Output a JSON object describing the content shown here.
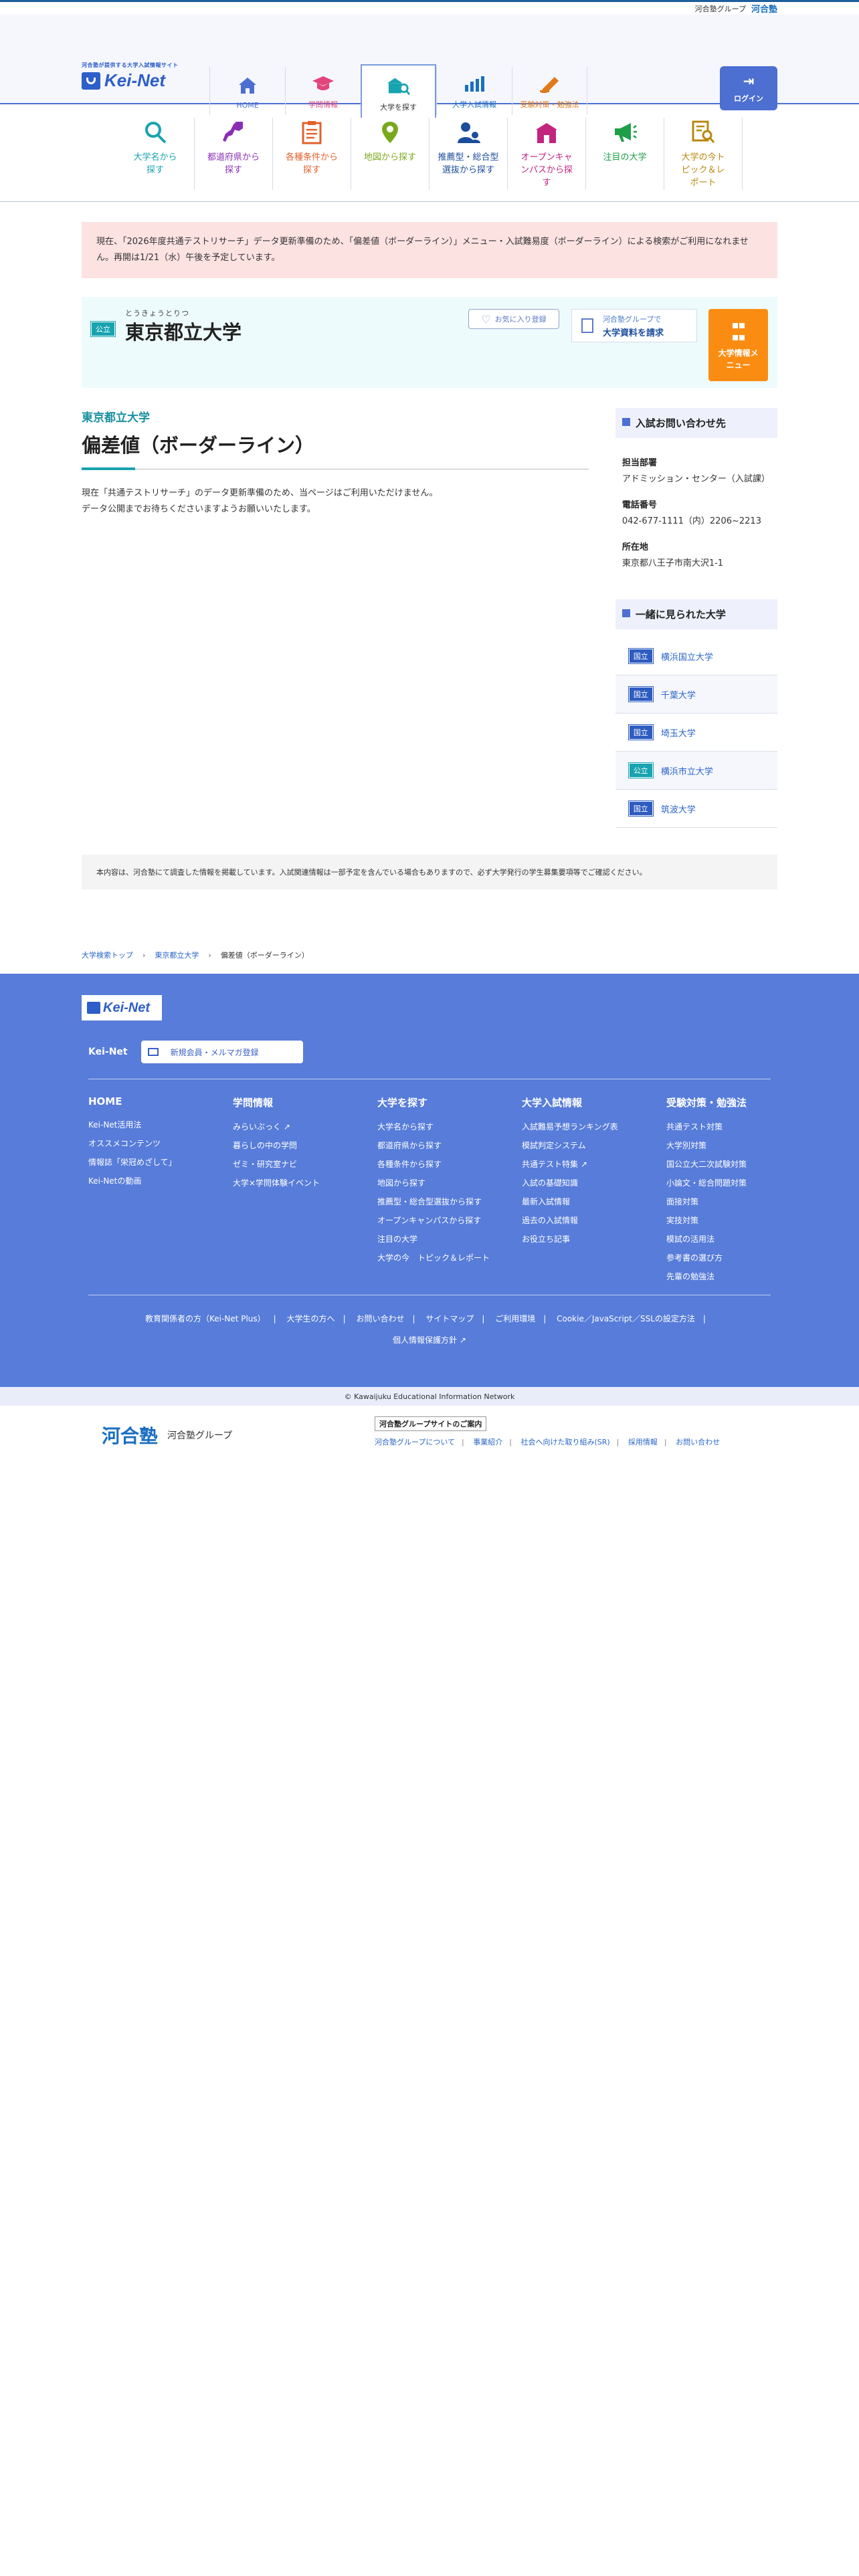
{
  "topbar": {
    "group_label": "河合塾グループ",
    "brand": "河合塾"
  },
  "logo": {
    "tagline": "河合塾が提供する大学入試情報サイト",
    "name": "Kei-Net"
  },
  "gnav": [
    {
      "label": "HOME",
      "icon": "home-icon",
      "color": "#4d6fd2"
    },
    {
      "label": "学問情報",
      "icon": "graduation-cap-icon",
      "color": "#e2457c"
    },
    {
      "label": "大学を探す",
      "icon": "university-search-icon",
      "color": "#18a3b0"
    },
    {
      "label": "大学入試情報",
      "icon": "bar-chart-icon",
      "color": "#1b6fc1"
    },
    {
      "label": "受験対策・勉強法",
      "icon": "pencil-icon",
      "color": "#e07a1b"
    }
  ],
  "login_label": "ログイン",
  "subnav": [
    {
      "label": "大学名から探す",
      "icon": "magnifier-icon",
      "color": "#18a3b0"
    },
    {
      "label": "都道府県から探す",
      "icon": "map-region-icon",
      "color": "#8a2fb5"
    },
    {
      "label": "各種条件から探す",
      "icon": "checklist-icon",
      "color": "#e2602d"
    },
    {
      "label": "地図から探す",
      "icon": "map-pin-icon",
      "color": "#7aa81c"
    },
    {
      "label": "推薦型・総合型選抜から探す",
      "icon": "people-icon",
      "color": "#1b4d9c"
    },
    {
      "label": "オープンキャンパスから探す",
      "icon": "campus-icon",
      "color": "#c2247e"
    },
    {
      "label": "注目の大学",
      "icon": "megaphone-icon",
      "color": "#1f9e4a"
    },
    {
      "label": "大学の今トピック＆レポート",
      "icon": "report-search-icon",
      "color": "#b8880f"
    }
  ],
  "notice": "現在、「2026年度共通テストリサーチ」データ更新準備のため、「偏差値（ボーダーライン）」メニュー・入試難易度（ボーダーライン）による検索がご利用になれません。再開は1/21（水）午後を予定しています。",
  "university": {
    "ruby": "とうきょうとりつ",
    "type_badge": "公立",
    "name": "東京都立大学",
    "favorite_label": "お気に入り登録",
    "request_line1": "河合塾グループで",
    "request_line2": "大学資料を請求",
    "menu_label": "大学情報メニュー"
  },
  "main": {
    "sub_title": "東京都立大学",
    "page_title": "偏差値（ボーダーライン）",
    "body_line1": "現在「共通テストリサーチ」のデータ更新準備のため、当ページはご利用いただけません。",
    "body_line2": "データ公開までお待ちくださいますようお願いいたします。"
  },
  "sidebar": {
    "contact_title": "入試お問い合わせ先",
    "contact": [
      {
        "label": "担当部署",
        "value": "アドミッション・センター（入試課）"
      },
      {
        "label": "電話番号",
        "value": "042-677-1111（内）2206~2213"
      },
      {
        "label": "所在地",
        "value": "東京都八王子市南大沢1-1"
      }
    ],
    "seen_title": "一緒に見られた大学",
    "seen": [
      {
        "tag": "国立",
        "name": "横浜国立大学"
      },
      {
        "tag": "国立",
        "name": "千葉大学"
      },
      {
        "tag": "国立",
        "name": "埼玉大学"
      },
      {
        "tag": "公立",
        "name": "横浜市立大学"
      },
      {
        "tag": "国立",
        "name": "筑波大学"
      }
    ]
  },
  "disclaimer": "本内容は、河合塾にて調査した情報を掲載しています。入試関連情報は一部予定を含んでいる場合もありますので、必ず大学発行の学生募集要項等でご確認ください。",
  "breadcrumb": [
    "大学検索トップ",
    "東京都立大学",
    "偏差値（ボーダーライン）"
  ],
  "footer": {
    "logo": "Kei-Net",
    "reg_label": "Kei-Net",
    "reg_button": "新規会員・メルマガ登録",
    "columns": [
      {
        "title": "HOME",
        "links": [
          "Kei-Net活用法",
          "オススメコンテンツ",
          "情報誌「栄冠めざして」",
          "Kei-Netの動画"
        ]
      },
      {
        "title": "学問情報",
        "links": [
          "みらいぶっく",
          "暮らしの中の学問",
          "ゼミ・研究室ナビ",
          "大学×学問体験イベント"
        ]
      },
      {
        "title": "大学を探す",
        "links": [
          "大学名から探す",
          "都道府県から探す",
          "各種条件から探す",
          "地図から探す",
          "推薦型・総合型選抜から探す",
          "オープンキャンパスから探す",
          "注目の大学",
          "大学の今　トピック＆レポート"
        ]
      },
      {
        "title": "大学入試情報",
        "links": [
          "入試難易予想ランキング表",
          "模試判定システム",
          "共通テスト特集",
          "入試の基礎知識",
          "最新入試情報",
          "過去の入試情報",
          "お役立ち記事"
        ]
      },
      {
        "title": "受験対策・勉強法",
        "links": [
          "共通テスト対策",
          "大学別対策",
          "国公立大二次試験対策",
          "小論文・総合問題対策",
          "面接対策",
          "実技対策",
          "模試の活用法",
          "参考書の選び方",
          "先輩の勉強法"
        ]
      }
    ],
    "bottom_links": [
      "教育関係者の方（Kei-Net Plus）",
      "大学生の方へ",
      "お問い合わせ",
      "サイトマップ",
      "ご利用環境",
      "Cookie／JavaScript／SSLの設定方法",
      "個人情報保護方針"
    ],
    "copyright": "© Kawaijuku Educational Information Network"
  },
  "group": {
    "brand": "河合塾",
    "brand_sub": "河合塾グループ",
    "info_title": "河合塾グループサイトのご案内",
    "links": [
      "河合塾グループについて",
      "事業紹介",
      "社会へ向けた取り組み(SR)",
      "採用情報",
      "お問い合わせ"
    ]
  }
}
